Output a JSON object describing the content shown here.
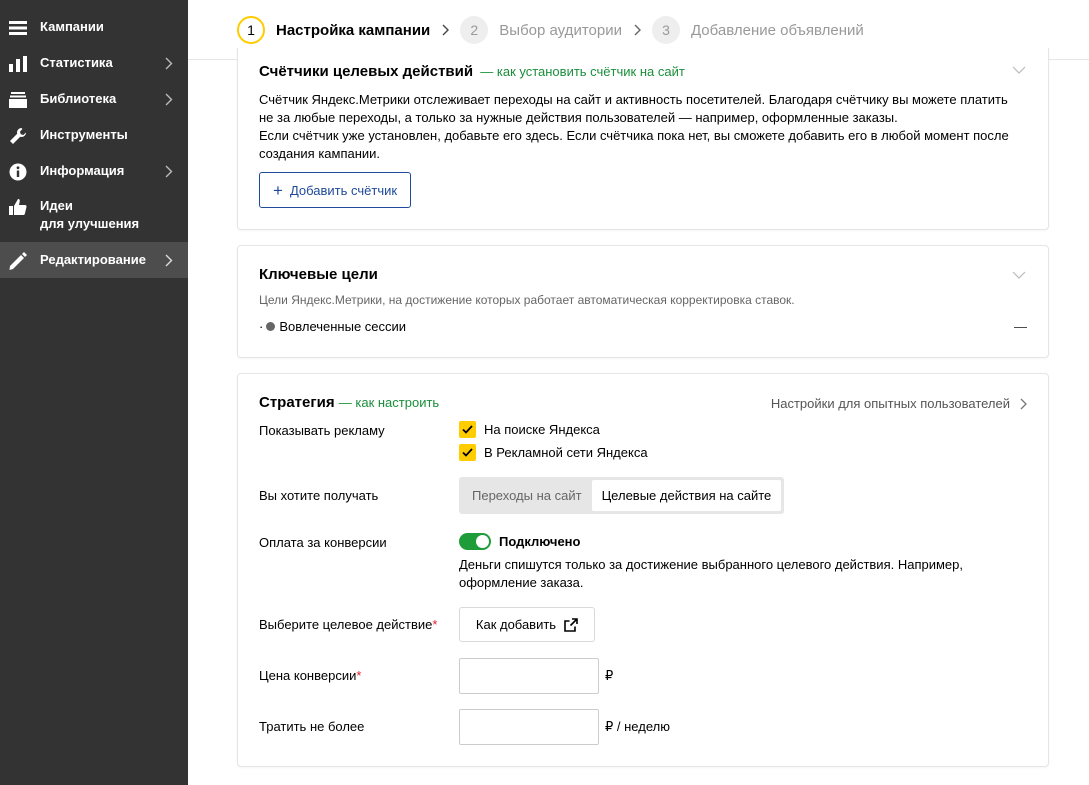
{
  "sidebar": {
    "items": [
      {
        "label": "Кампании",
        "icon": "menu-icon"
      },
      {
        "label": "Статистика",
        "icon": "bar-chart-icon"
      },
      {
        "label": "Библиотека",
        "icon": "library-icon"
      },
      {
        "label": "Инструменты",
        "icon": "wrench-icon"
      },
      {
        "label": "Информация",
        "icon": "info-icon"
      },
      {
        "label": "Идеи\nдля улучшения",
        "icon": "thumbs-up-icon"
      },
      {
        "label": "Редактирование",
        "icon": "pencil-icon"
      }
    ]
  },
  "stepper": {
    "steps": [
      {
        "num": "1",
        "label": "Настройка кампании"
      },
      {
        "num": "2",
        "label": "Выбор аудитории"
      },
      {
        "num": "3",
        "label": "Добавление объявлений"
      }
    ]
  },
  "counters": {
    "title": "Счётчики целевых действий",
    "link": "— как установить счётчик на сайт",
    "line1": "Счётчик Яндекс.Метрики отслеживает переходы на сайт и активность посетителей. Благодаря счётчику вы можете платить",
    "line2": "не за любые переходы, а только за нужные действия пользователей — например, оформленные заказы.",
    "line3": "Если счётчик уже установлен, добавьте его здесь. Если счётчика пока нет, вы сможете добавить его в любой момент после",
    "line4": "создания кампании.",
    "add_button": "Добавить счётчик"
  },
  "goals": {
    "title": "Ключевые цели",
    "description": "Цели Яндекс.Метрики, на достижение которых работает автоматическая корректировка ставок.",
    "item": "Вовлеченные сессии",
    "item_bullet": "·",
    "item_value": "—"
  },
  "strategy": {
    "title": "Стратегия",
    "link": "— как настроить",
    "advanced": "Настройки для опытных пользователей",
    "show_ads_label": "Показывать рекламу",
    "search_label": "На поиске Яндекса",
    "network_label": "В Рекламной сети Яндекса",
    "want_label": "Вы хотите получать",
    "option_clicks": "Переходы на сайт",
    "option_actions": "Целевые действия на сайте",
    "payment_label": "Оплата за конверсии",
    "payment_status": "Подключено",
    "payment_note1": "Деньги спишутся только за достижение выбранного целевого действия. Например,",
    "payment_note2": "оформление заказа.",
    "target_label": "Выберите целевое действие",
    "required_mark": "*",
    "how_to_add": "Как добавить",
    "price_label": "Цена конверсии",
    "currency": "₽",
    "budget_label": "Тратить не более",
    "budget_unit": "₽ / неделю"
  },
  "colors": {
    "sidebar_bg": "#333333",
    "accent_yellow": "#ffcc00",
    "link_green": "#1a8f3b",
    "toggle_green": "#1f9c3a",
    "button_blue": "#1e4a99",
    "required_red": "#e0202b"
  }
}
